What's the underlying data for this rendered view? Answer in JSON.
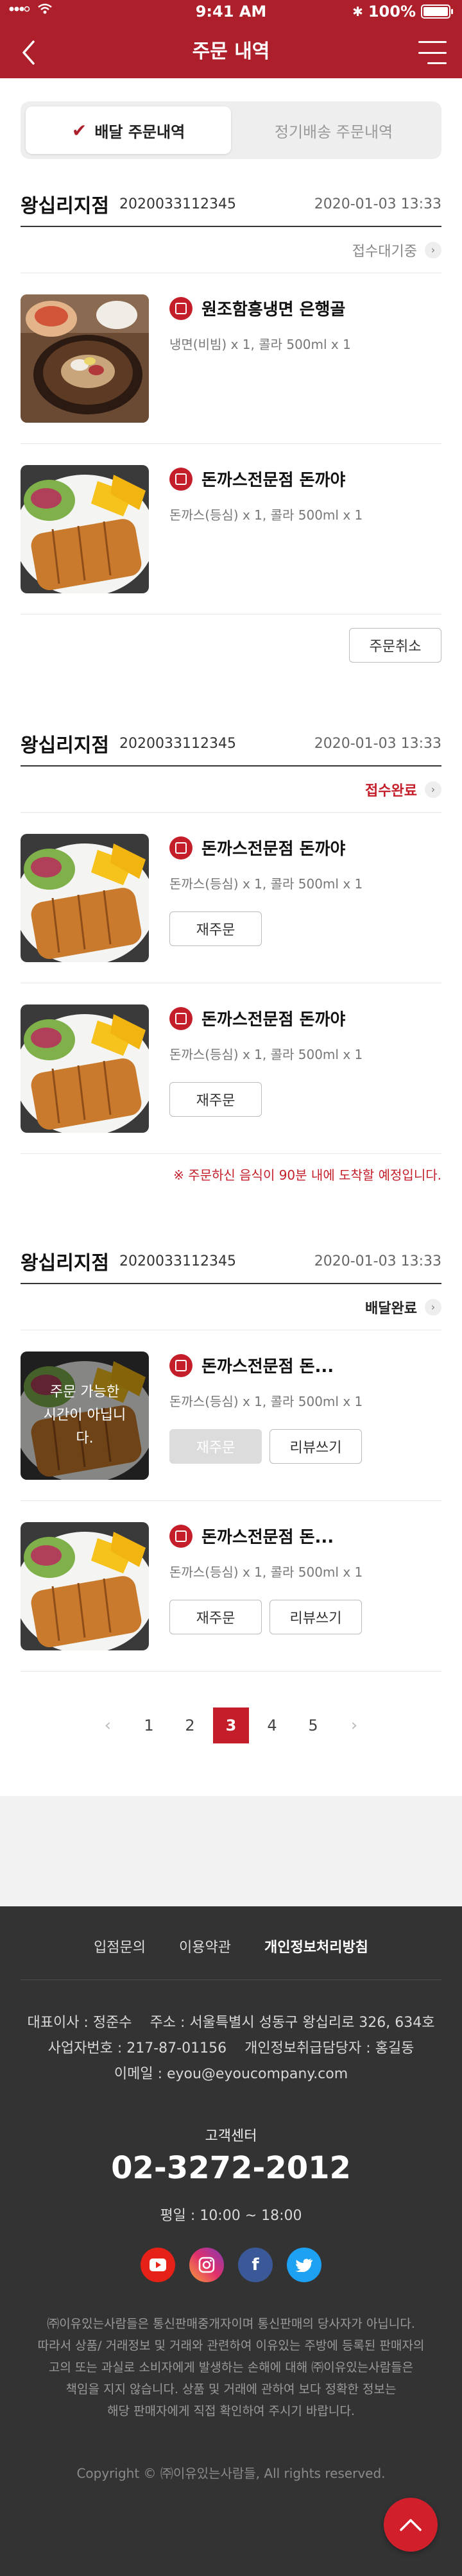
{
  "status_bar": {
    "time": "9:41 AM",
    "battery": "100%"
  },
  "header": {
    "title": "주문 내역"
  },
  "tabs": [
    {
      "label": "배달 주문내역",
      "active": true
    },
    {
      "label": "정기배송 주문내역",
      "active": false
    }
  ],
  "orders": [
    {
      "store": "왕십리지점",
      "order_no": "2020033112345",
      "date": "2020-01-03 13:33",
      "status": "접수대기중",
      "items": [
        {
          "title": "원조함흥냉면 은행골",
          "desc": "냉면(비빔) x 1, 콜라 500ml x 1",
          "image": "cold-noodle"
        },
        {
          "title": "돈까스전문점 돈까야",
          "desc": "돈까스(등심) x 1, 콜라 500ml x 1",
          "image": "pork-cutlet"
        }
      ],
      "cancel_label": "주문취소"
    },
    {
      "store": "왕십리지점",
      "order_no": "2020033112345",
      "date": "2020-01-03 13:33",
      "status": "접수완료",
      "items": [
        {
          "title": "돈까스전문점 돈까야",
          "desc": "돈까스(등심) x 1, 콜라 500ml x 1",
          "button": "재주문",
          "image": "pork-cutlet"
        },
        {
          "title": "돈까스전문점 돈까야",
          "desc": "돈까스(등심) x 1, 콜라 500ml x 1",
          "button": "재주문",
          "image": "pork-cutlet"
        }
      ],
      "notice": "※ 주문하신 음식이 90분 내에 도착할 예정입니다."
    },
    {
      "store": "왕십리지점",
      "order_no": "2020033112345",
      "date": "2020-01-03 13:33",
      "status": "배달완료",
      "items": [
        {
          "title": "돈까스전문점 돈...",
          "desc": "돈까스(등심) x 1, 콜라 500ml x 1",
          "reorder": "재주문",
          "review": "리뷰쓰기",
          "overlay": "주문 가능한 시간이 아닙니다.",
          "image": "pork-cutlet"
        },
        {
          "title": "돈까스전문점 돈...",
          "desc": "돈까스(등심) x 1, 콜라 500ml x 1",
          "reorder": "재주문",
          "review": "리뷰쓰기",
          "image": "pork-cutlet"
        }
      ]
    }
  ],
  "pagination": {
    "prev": "‹",
    "pages": [
      "1",
      "2",
      "3",
      "4",
      "5"
    ],
    "current": "3",
    "next": "›"
  },
  "footer": {
    "links": [
      "입점문의",
      "이용약관",
      "개인정보처리방침"
    ],
    "ceo": "대표이사 : 정준수",
    "address": "주소 : 서울특별시 성동구 왕십리로 326, 634호",
    "biz_no": "사업자번호 : 217-87-01156",
    "privacy_officer": "개인정보취급담당자 : 홍길동",
    "email": "이메일 : eyou@eyoucompany.com",
    "cs_label": "고객센터",
    "cs_phone": "02-3272-2012",
    "cs_hours": "평일 : 10:00 ~ 18:00",
    "socials": [
      {
        "name": "youtube",
        "color": "#e62117"
      },
      {
        "name": "instagram",
        "color": "#c13584"
      },
      {
        "name": "facebook",
        "color": "#3b5998"
      },
      {
        "name": "twitter",
        "color": "#1da1f2"
      }
    ],
    "disclaimer": [
      "㈜이유있는사람들은 통신판매중개자이며 통신판매의 당사자가 아닙니다.",
      "따라서 상품/ 거래정보 및 거래와 관련하여 이유있는 주방에 등록된 판매자의",
      "고의 또는 과실로 소비자에게 발생하는 손해에 대해 ㈜이유있는사람들은",
      "책임을 지지 않습니다. 상품 및 거래에 관하여 보다 정확한 정보는",
      "해당 판매자에게 직접 확인하여 주시기 바랍니다."
    ],
    "copyright": "Copyright © ㈜이유있는사람들, All rights reserved."
  },
  "colors": {
    "brand": "#ad1f2a",
    "accent": "#c41e2a",
    "footer_bg": "#333333"
  }
}
